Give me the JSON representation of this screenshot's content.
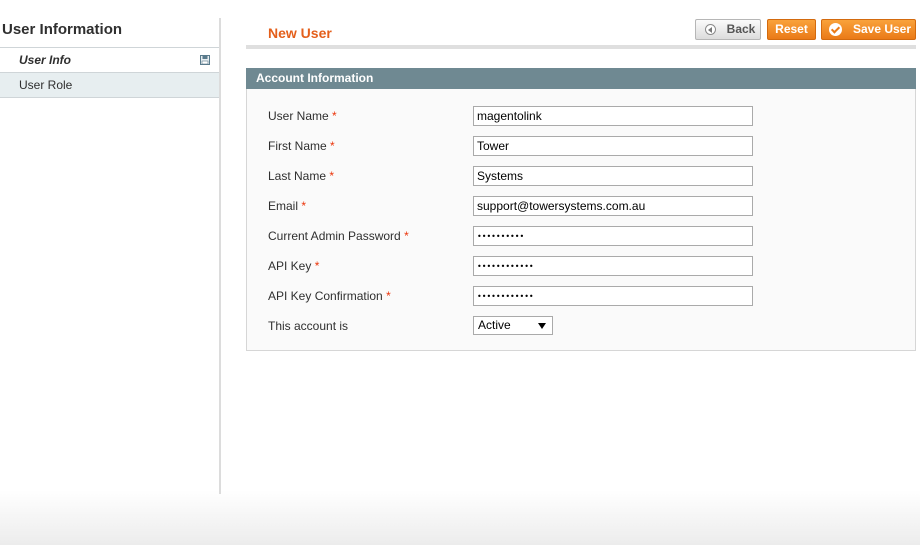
{
  "sidebar": {
    "title": "User Information",
    "items": [
      {
        "label": "User Info",
        "active": true
      },
      {
        "label": "User Role",
        "active": false
      }
    ]
  },
  "header": {
    "title": "New User",
    "back_label": "Back",
    "reset_label": "Reset",
    "save_label": "Save User"
  },
  "form": {
    "section_title": "Account Information",
    "required_mark": "*",
    "fields": [
      {
        "label": "User Name",
        "value": "magentolink",
        "type": "text",
        "required": true
      },
      {
        "label": "First Name",
        "value": "Tower",
        "type": "text",
        "required": true
      },
      {
        "label": "Last Name",
        "value": "Systems",
        "type": "text",
        "required": true
      },
      {
        "label": "Email",
        "value": "support@towersystems.com.au",
        "type": "text",
        "required": true
      },
      {
        "label": "Current Admin Password",
        "value": "••••••••••",
        "type": "password",
        "required": true
      },
      {
        "label": "API Key",
        "value": "••••••••••••",
        "type": "password",
        "required": true
      },
      {
        "label": "API Key Confirmation",
        "value": "••••••••••••",
        "type": "password",
        "required": true
      }
    ],
    "status": {
      "label": "This account is",
      "value": "Active"
    }
  },
  "colors": {
    "accent": "#e45f1b",
    "button_orange": "#ea7a17",
    "section_header": "#6f8992",
    "required": "#eb340a"
  },
  "icons": {
    "save_tab": "floppy-disk-icon",
    "back": "arrow-left-circle-icon",
    "save": "checkmark-circle-icon",
    "dropdown": "triangle-down-icon"
  }
}
